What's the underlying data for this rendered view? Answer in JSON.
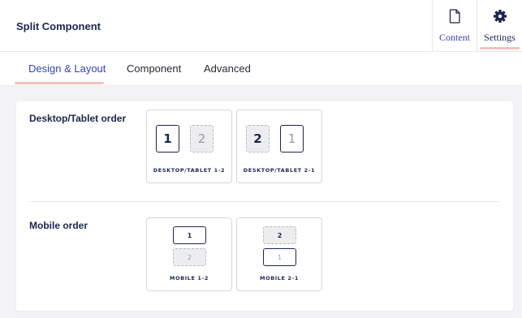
{
  "header": {
    "title": "Split Component",
    "tabs": [
      {
        "label": "Content",
        "icon": "document-icon"
      },
      {
        "label": "Settings",
        "icon": "gear-icon"
      }
    ]
  },
  "subtabs": [
    {
      "label": "Design & Layout",
      "active": true
    },
    {
      "label": "Component",
      "active": false
    },
    {
      "label": "Advanced",
      "active": false
    }
  ],
  "desktop": {
    "label": "Desktop/Tablet order",
    "options": [
      {
        "caption": "DESKTOP/TABLET 1-2",
        "first": "1",
        "second": "2"
      },
      {
        "caption": "DESKTOP/TABLET 2-1",
        "first": "2",
        "second": "1"
      }
    ]
  },
  "mobile": {
    "label": "Mobile order",
    "options": [
      {
        "caption": "MOBILE 1-2",
        "first": "1",
        "second": "2"
      },
      {
        "caption": "MOBILE 2-1",
        "first": "2",
        "second": "1"
      }
    ]
  },
  "colors": {
    "accent": "#3544b1",
    "text": "#1b264f",
    "tab_underline": "#f5c1bc",
    "background": "#f3f3f5"
  }
}
